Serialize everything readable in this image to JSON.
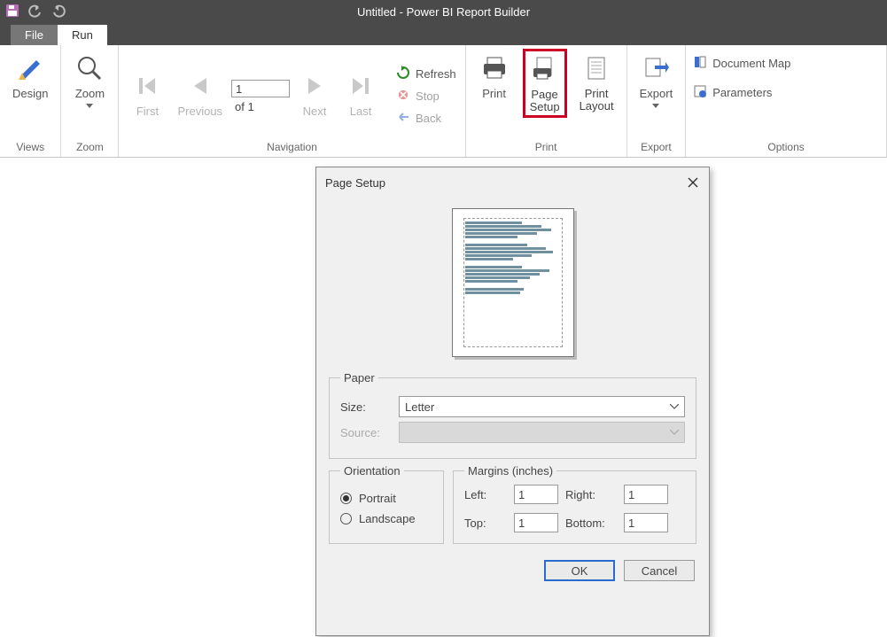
{
  "app_title": "Untitled - Power BI Report Builder",
  "tabs": {
    "file": "File",
    "run": "Run"
  },
  "ribbon": {
    "views": {
      "design": "Design",
      "label": "Views"
    },
    "zoom": {
      "zoom": "Zoom",
      "label": "Zoom"
    },
    "navigation": {
      "first": "First",
      "previous": "Previous",
      "next": "Next",
      "last": "Last",
      "page_value": "1",
      "page_of": "of  1",
      "refresh": "Refresh",
      "stop": "Stop",
      "back": "Back",
      "label": "Navigation"
    },
    "print_group": {
      "print": "Print",
      "page_setup_l1": "Page",
      "page_setup_l2": "Setup",
      "print_layout_l1": "Print",
      "print_layout_l2": "Layout",
      "label": "Print"
    },
    "export_group": {
      "export": "Export",
      "label": "Export"
    },
    "options_group": {
      "docmap": "Document Map",
      "parameters": "Parameters",
      "label": "Options"
    }
  },
  "dialog": {
    "title": "Page Setup",
    "paper": {
      "legend": "Paper",
      "size_label": "Size:",
      "size_value": "Letter",
      "source_label": "Source:"
    },
    "orientation": {
      "legend": "Orientation",
      "portrait": "Portrait",
      "landscape": "Landscape",
      "selected": "Portrait"
    },
    "margins": {
      "legend": "Margins (inches)",
      "left_label": "Left:",
      "left": "1",
      "right_label": "Right:",
      "right": "1",
      "top_label": "Top:",
      "top": "1",
      "bottom_label": "Bottom:",
      "bottom": "1"
    },
    "ok": "OK",
    "cancel": "Cancel"
  }
}
